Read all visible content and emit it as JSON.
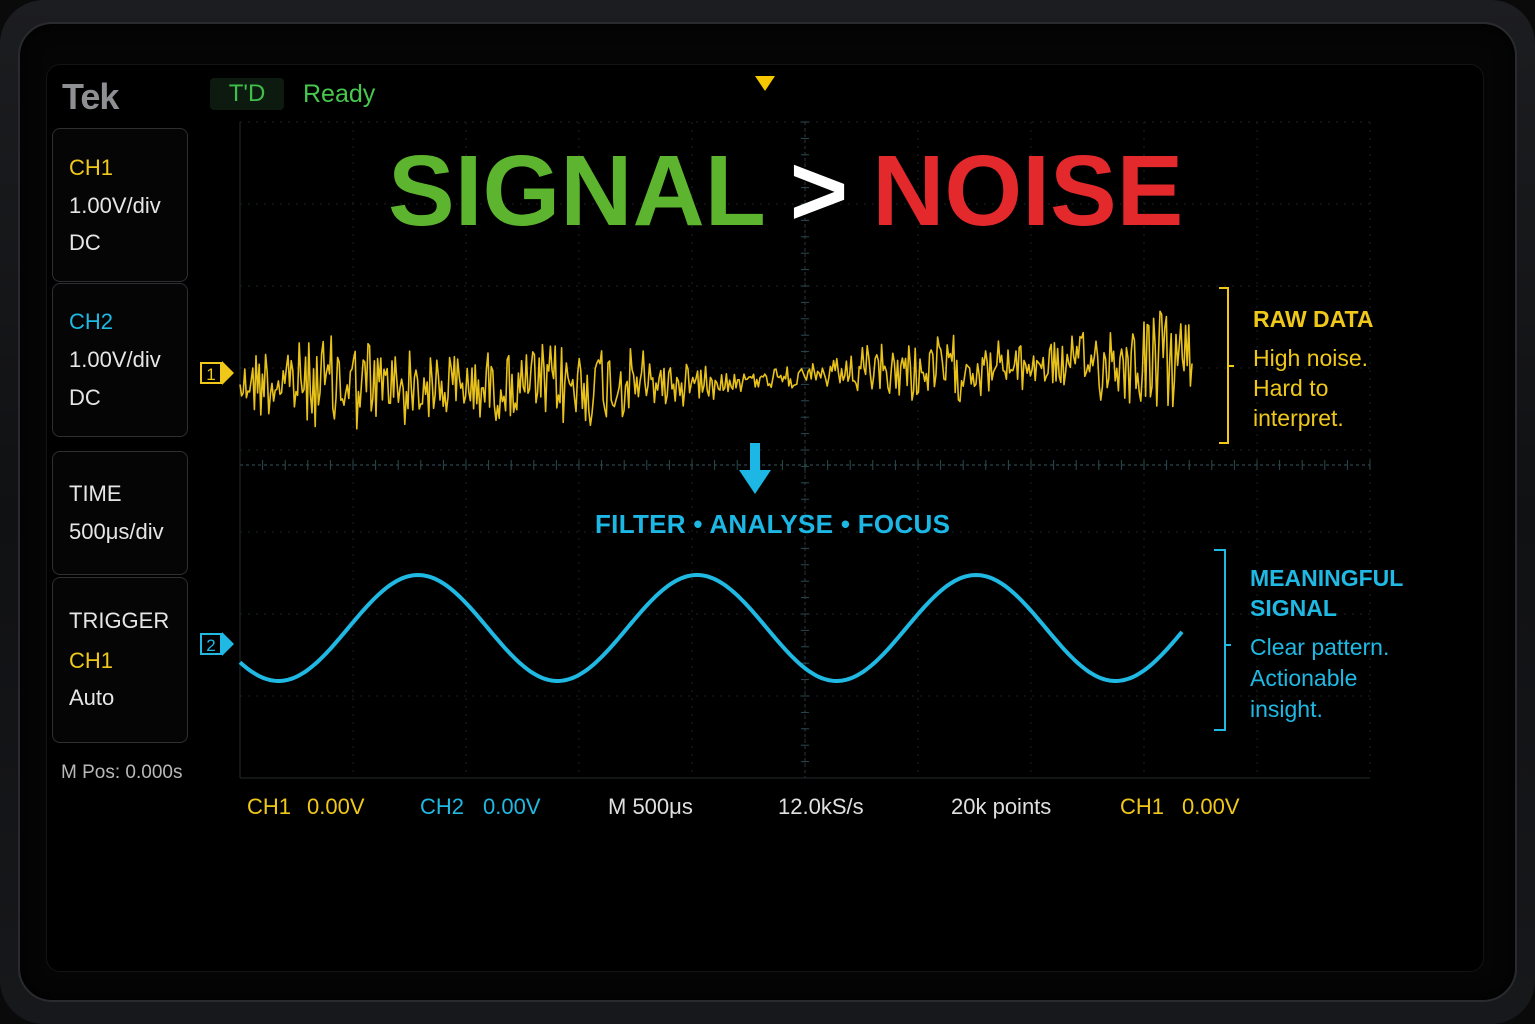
{
  "brand": "Tek",
  "status": {
    "trigger_state": "T'D",
    "acquisition": "Ready"
  },
  "headline": {
    "signal": "SIGNAL",
    "gt": ">",
    "noise": "NOISE"
  },
  "panels": {
    "ch1": {
      "label": "CH1",
      "scale": "1.00V/div",
      "coupling": "DC"
    },
    "ch2": {
      "label": "CH2",
      "scale": "1.00V/div",
      "coupling": "DC"
    },
    "time": {
      "label": "TIME",
      "scale": "500μs/div"
    },
    "trigger": {
      "label": "TRIGGER",
      "source": "CH1",
      "mode": "Auto"
    }
  },
  "m_pos": "M Pos: 0.000s",
  "channel_markers": {
    "ch1": "1",
    "ch2": "2"
  },
  "raw_note": {
    "title": "RAW DATA",
    "lines": [
      "High noise.",
      "Hard to",
      "interpret."
    ]
  },
  "filter_label": "FILTER • ANALYSE • FOCUS",
  "signal_note": {
    "title_lines": [
      "MEANINGFUL",
      "SIGNAL"
    ],
    "lines": [
      "Clear pattern.",
      "Actionable",
      "insight."
    ]
  },
  "readouts": {
    "ch1_label": "CH1",
    "ch1_value": "0.00V",
    "ch2_label": "CH2",
    "ch2_value": "0.00V",
    "timebase": "M 500μs",
    "sample_rate": "12.0kS/s",
    "record_length": "20k points",
    "trig_label": "CH1",
    "trig_value": "0.00V"
  },
  "colors": {
    "ch1": "#f0c81a",
    "ch2": "#1fb9e3",
    "signal_headline": "#5db52f",
    "noise_headline": "#e3292c",
    "status_green": "#46c84f"
  }
}
